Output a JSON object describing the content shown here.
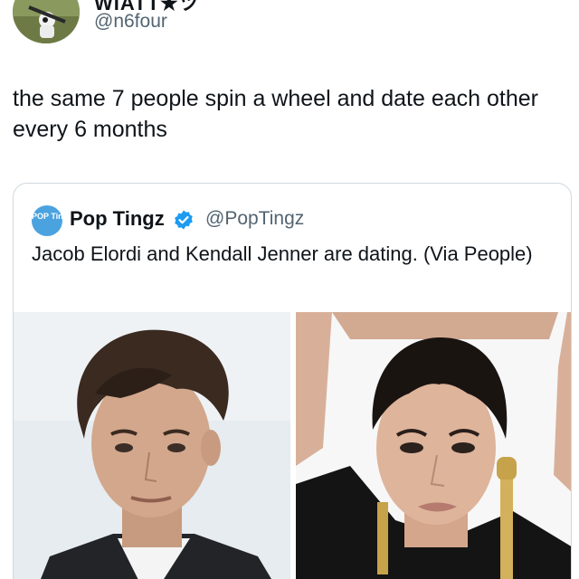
{
  "author": {
    "display_name": "WIATT★ツ",
    "handle": "@n6four",
    "avatar_icon": "profile-photo-icon"
  },
  "tweet": {
    "text": "the same 7 people spin a wheel and date each other every 6 months"
  },
  "quoted": {
    "avatar_text": "POP Tingz",
    "name": "Pop Tingz",
    "verified_icon": "verified-badge-icon",
    "handle": "@PopTingz",
    "text": "Jacob Elordi and Kendall Jenner are dating. (Via People)"
  },
  "colors": {
    "text": "#0f1419",
    "secondary": "#536471",
    "border": "#cfd9de",
    "verified": "#1d9bf0"
  }
}
